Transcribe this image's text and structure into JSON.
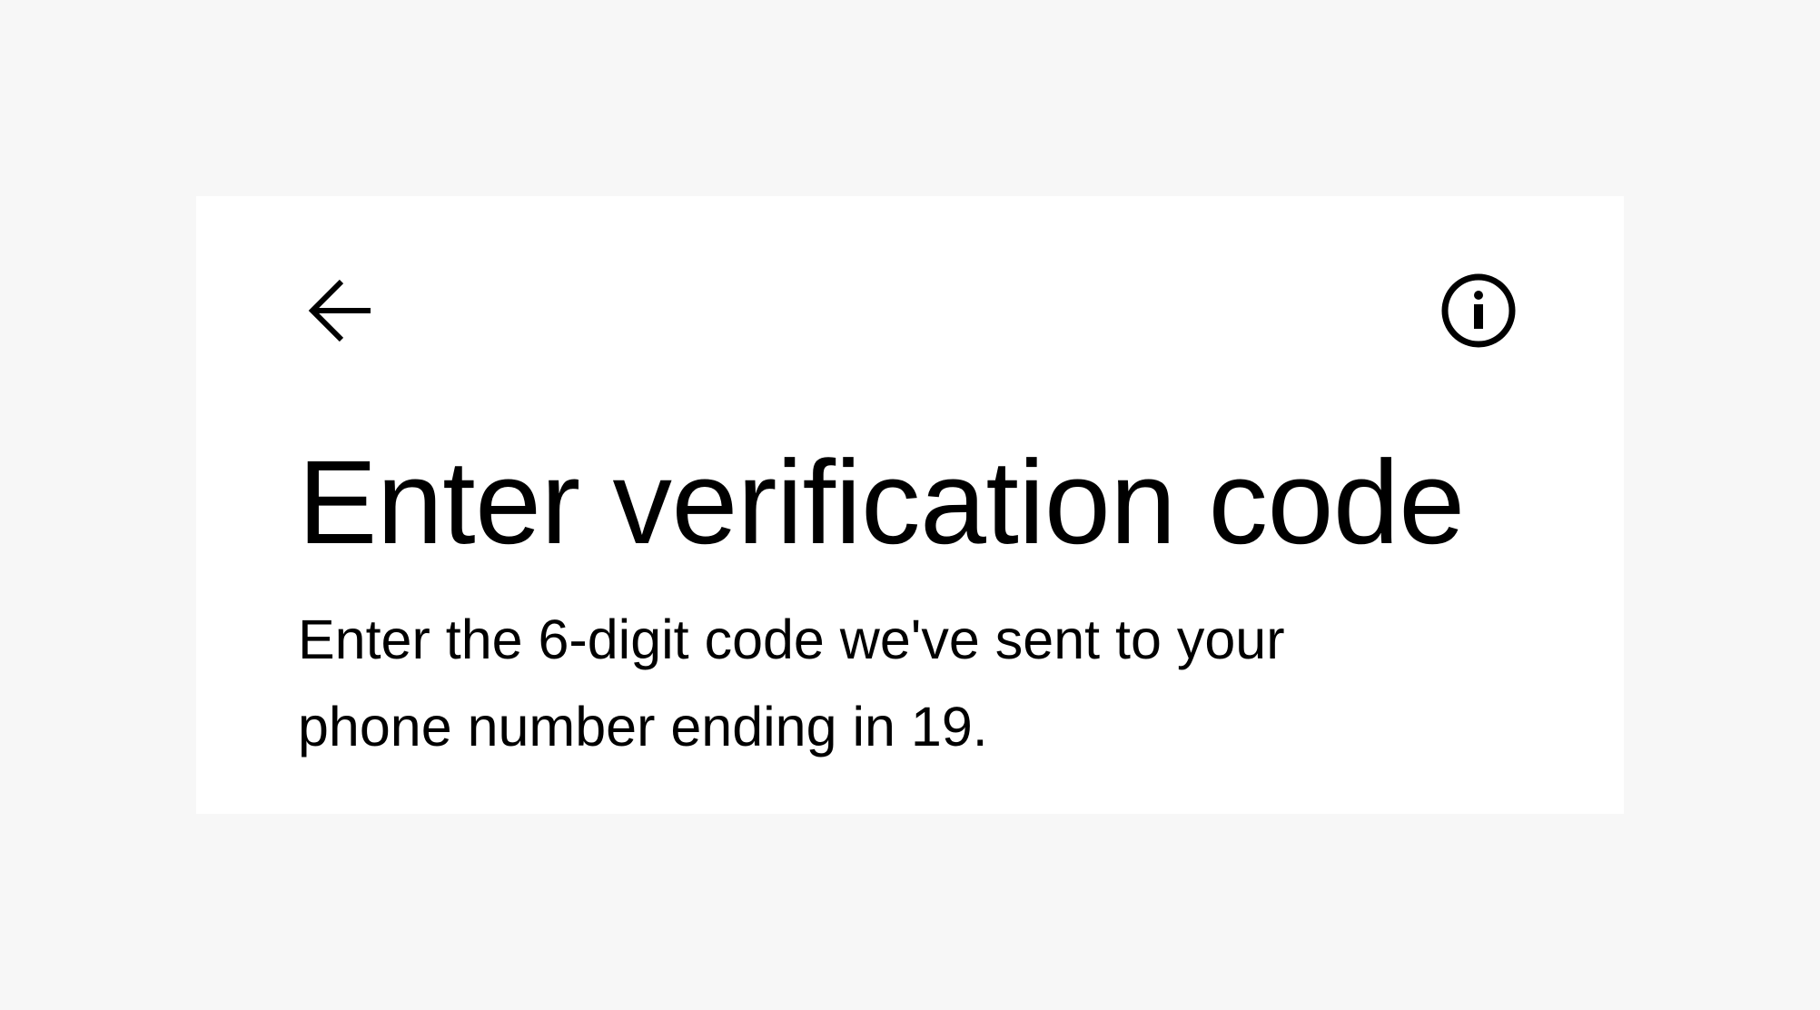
{
  "header": {
    "back_icon": "arrow-left-icon",
    "info_icon": "info-circle-icon"
  },
  "main": {
    "title": "Enter verification code",
    "subtitle": "Enter the 6-digit code we've sent to your phone number ending in 19."
  },
  "colors": {
    "page_background": "#f7f7f7",
    "card_background": "#ffffff",
    "text": "#000000"
  }
}
